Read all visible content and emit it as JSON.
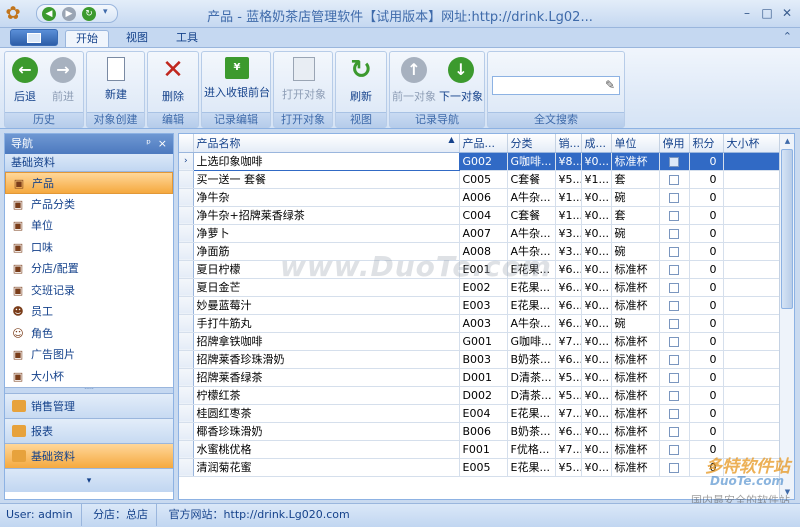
{
  "window": {
    "title": "产品 - 蓝格奶茶店管理软件【试用版本】网址:http://drink.Lg02..."
  },
  "ribbon_tabs": [
    {
      "label": "开始",
      "active": true
    },
    {
      "label": "视图",
      "active": false
    },
    {
      "label": "工具",
      "active": false
    }
  ],
  "ribbon": {
    "groups": [
      {
        "label": "历史",
        "buttons": [
          {
            "label": "后退",
            "icon": "arrow-left-icon",
            "disabled": false
          },
          {
            "label": "前进",
            "icon": "arrow-right-icon",
            "disabled": true
          }
        ]
      },
      {
        "label": "对象创建",
        "buttons": [
          {
            "label": "新建",
            "icon": "new-document-icon",
            "disabled": false
          }
        ]
      },
      {
        "label": "编辑",
        "buttons": [
          {
            "label": "删除",
            "icon": "delete-icon",
            "disabled": false
          }
        ]
      },
      {
        "label": "记录编辑",
        "buttons": [
          {
            "label": "进入收银前台",
            "icon": "cashier-icon",
            "disabled": false
          }
        ]
      },
      {
        "label": "打开对象",
        "buttons": [
          {
            "label": "打开对象",
            "icon": "open-object-icon",
            "disabled": true
          }
        ]
      },
      {
        "label": "视图",
        "buttons": [
          {
            "label": "刷新",
            "icon": "refresh-icon",
            "disabled": false
          }
        ]
      },
      {
        "label": "记录导航",
        "buttons": [
          {
            "label": "前一对象",
            "icon": "arrow-up-icon",
            "disabled": true
          },
          {
            "label": "下一对象",
            "icon": "arrow-down-icon",
            "disabled": false
          }
        ]
      },
      {
        "label": "全文搜索",
        "buttons": []
      }
    ]
  },
  "nav": {
    "header": "导航",
    "section": "基础资料",
    "items": [
      {
        "label": "产品",
        "icon": "product-icon",
        "selected": true
      },
      {
        "label": "产品分类",
        "icon": "category-icon",
        "selected": false
      },
      {
        "label": "单位",
        "icon": "unit-icon",
        "selected": false
      },
      {
        "label": "口味",
        "icon": "flavor-icon",
        "selected": false
      },
      {
        "label": "分店/配置",
        "icon": "branch-icon",
        "selected": false
      },
      {
        "label": "交班记录",
        "icon": "shift-record-icon",
        "selected": false
      },
      {
        "label": "员工",
        "icon": "employee-icon",
        "selected": false
      },
      {
        "label": "角色",
        "icon": "role-icon",
        "selected": false
      },
      {
        "label": "广告图片",
        "icon": "ad-image-icon",
        "selected": false
      },
      {
        "label": "大小杯",
        "icon": "cup-size-icon",
        "selected": false
      }
    ],
    "bottom_buttons": [
      {
        "label": "销售管理",
        "selected": false
      },
      {
        "label": "报表",
        "selected": false
      },
      {
        "label": "基础资料",
        "selected": true
      }
    ]
  },
  "grid": {
    "columns": [
      "产品名称",
      "产品...",
      "分类",
      "销...",
      "成...",
      "单位",
      "停用",
      "积分",
      "大小杯"
    ],
    "rows": [
      [
        "上选印象咖啡",
        "G002",
        "G咖啡...",
        "¥8...",
        "¥0...",
        "标准杯",
        "0"
      ],
      [
        "买一送一 套餐",
        "C005",
        "C套餐",
        "¥5...",
        "¥1...",
        "套",
        "0"
      ],
      [
        "净牛杂",
        "A006",
        "A牛杂...",
        "¥1...",
        "¥0...",
        "碗",
        "0"
      ],
      [
        "净牛杂+招牌莱香绿茶",
        "C004",
        "C套餐",
        "¥1...",
        "¥0...",
        "套",
        "0"
      ],
      [
        "净萝卜",
        "A007",
        "A牛杂...",
        "¥3...",
        "¥0...",
        "碗",
        "0"
      ],
      [
        "净面筋",
        "A008",
        "A牛杂...",
        "¥3...",
        "¥0...",
        "碗",
        "0"
      ],
      [
        "夏日柠檬",
        "E001",
        "E花果...",
        "¥6...",
        "¥0...",
        "标准杯",
        "0"
      ],
      [
        "夏日金芒",
        "E002",
        "E花果...",
        "¥6...",
        "¥0...",
        "标准杯",
        "0"
      ],
      [
        "妙曼蓝莓汁",
        "E003",
        "E花果...",
        "¥6...",
        "¥0...",
        "标准杯",
        "0"
      ],
      [
        "手打牛筋丸",
        "A003",
        "A牛杂...",
        "¥6...",
        "¥0...",
        "碗",
        "0"
      ],
      [
        "招牌拿铁咖啡",
        "G001",
        "G咖啡...",
        "¥7...",
        "¥0...",
        "标准杯",
        "0"
      ],
      [
        "招牌莱香珍珠滑奶",
        "B003",
        "B奶茶...",
        "¥6...",
        "¥0...",
        "标准杯",
        "0"
      ],
      [
        "招牌莱香绿茶",
        "D001",
        "D清茶...",
        "¥5...",
        "¥0...",
        "标准杯",
        "0"
      ],
      [
        "柠檬红茶",
        "D002",
        "D清茶...",
        "¥5...",
        "¥0...",
        "标准杯",
        "0"
      ],
      [
        "桂圆红枣茶",
        "E004",
        "E花果...",
        "¥7...",
        "¥0...",
        "标准杯",
        "0"
      ],
      [
        "椰香珍珠滑奶",
        "B006",
        "B奶茶...",
        "¥6...",
        "¥0...",
        "标准杯",
        "0"
      ],
      [
        "水蜜桃优格",
        "F001",
        "F优格...",
        "¥7...",
        "¥0...",
        "标准杯",
        "0"
      ],
      [
        "清润菊花蜜",
        "E005",
        "E花果...",
        "¥5...",
        "¥0...",
        "标准杯",
        "0"
      ]
    ],
    "selected_row": 0,
    "current_row_marker": "›"
  },
  "statusbar": {
    "user": "User: admin",
    "branch": "分店：总店",
    "website": "官方网站：http://drink.Lg020.com"
  },
  "watermark": {
    "text": "www.DuoTe.com",
    "corner_brand": "多特软件站",
    "corner_url": "DuoTe.com",
    "corner_slogan": "国内最安全的软件站"
  },
  "colors": {
    "accent": "#316ac5",
    "nav_selected": "#f5a93f",
    "ribbon_bg": "#dae6f6"
  }
}
